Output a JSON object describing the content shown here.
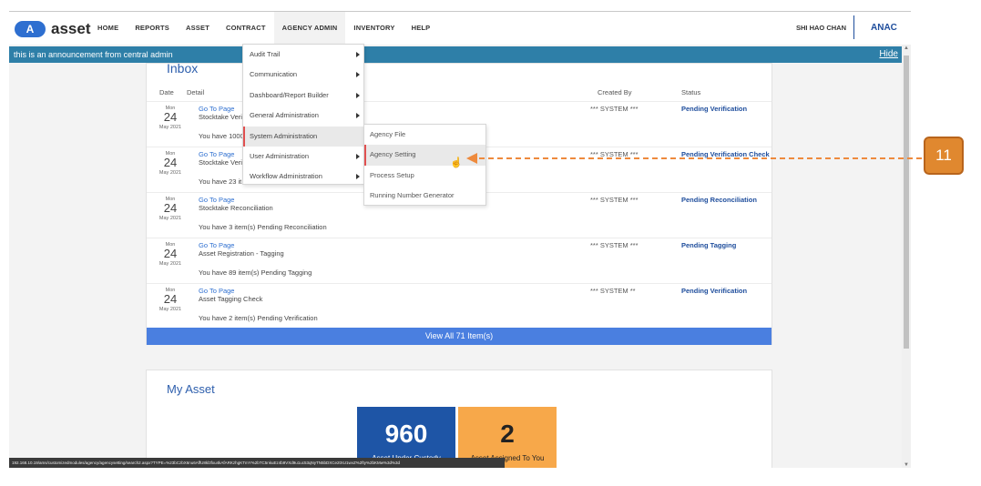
{
  "nav": {
    "logo_badge": "A",
    "logo_text": "asset",
    "items": [
      "HOME",
      "REPORTS",
      "ASSET",
      "CONTRACT",
      "AGENCY ADMIN",
      "INVENTORY",
      "HELP"
    ],
    "user_name": "SHI HAO CHAN",
    "agency_code": "ANAC"
  },
  "announcement": {
    "text": "this is an announcement from central admin",
    "hide_label": "Hide"
  },
  "inbox": {
    "title": "Inbox",
    "columns": {
      "date": "Date",
      "detail": "Detail",
      "created_by": "Created By",
      "status": "Status"
    },
    "rows": [
      {
        "day": "Mon",
        "date": "24",
        "month": "May 2021",
        "link": "Go To Page",
        "subject": "Stocktake Veri",
        "message": "You have 1000",
        "created_by": "*** SYSTEM ***",
        "status": "Pending Verification"
      },
      {
        "day": "Mon",
        "date": "24",
        "month": "May 2021",
        "link": "Go To Page",
        "subject": "Stocktake Veri",
        "message": "You have 23 it",
        "created_by": "*** SYSTEM ***",
        "status": "Pending Verification Check"
      },
      {
        "day": "Mon",
        "date": "24",
        "month": "May 2021",
        "link": "Go To Page",
        "subject": "Stocktake Reconciliation",
        "message": "You have 3 item(s) Pending Reconciliation",
        "created_by": "*** SYSTEM ***",
        "status": "Pending Reconciliation"
      },
      {
        "day": "Mon",
        "date": "24",
        "month": "May 2021",
        "link": "Go To Page",
        "subject": "Asset Registration - Tagging",
        "message": "You have 89 item(s) Pending Tagging",
        "created_by": "*** SYSTEM ***",
        "status": "Pending Tagging"
      },
      {
        "day": "Mon",
        "date": "24",
        "month": "May 2021",
        "link": "Go To Page",
        "subject": "Asset Tagging Check",
        "message": "You have 2 item(s) Pending Verification",
        "created_by": "*** SYSTEM **",
        "status": "Pending Verification"
      }
    ],
    "view_all": "View All 71 Item(s)"
  },
  "my_asset": {
    "title": "My Asset",
    "tiles": [
      {
        "value": "960",
        "label": "Asset Under Custody",
        "color": "#1e55a6"
      },
      {
        "value": "2",
        "label": "Asset Assigned To You",
        "color": "#f7a84a"
      }
    ]
  },
  "agency_admin_menu": {
    "items": [
      "Audit Trail",
      "Communication",
      "Dashboard/Report Builder",
      "General Administration",
      "System Administration",
      "User Administration",
      "Workflow Administration"
    ],
    "active": "System Administration"
  },
  "system_admin_submenu": {
    "items": [
      "Agency File",
      "Agency Setting",
      "Process Setup",
      "Running Number Generator"
    ],
    "hovered": "Agency Setting"
  },
  "status_url": "192.168.10.19/ams/customizedmodules/agency/agencysetting/search2.aspx?TYPE=%23bCzbX6nu6AffU8kl3fxu4kAfARKzhgKTmY%2bTC5nkuEz4b9VXd9u1uc53qNyTN5bDXCe2tXU1wvZ%2fty%2bKMw%3d%3d",
  "annotation": {
    "step": "11",
    "color": "#e0882f"
  }
}
